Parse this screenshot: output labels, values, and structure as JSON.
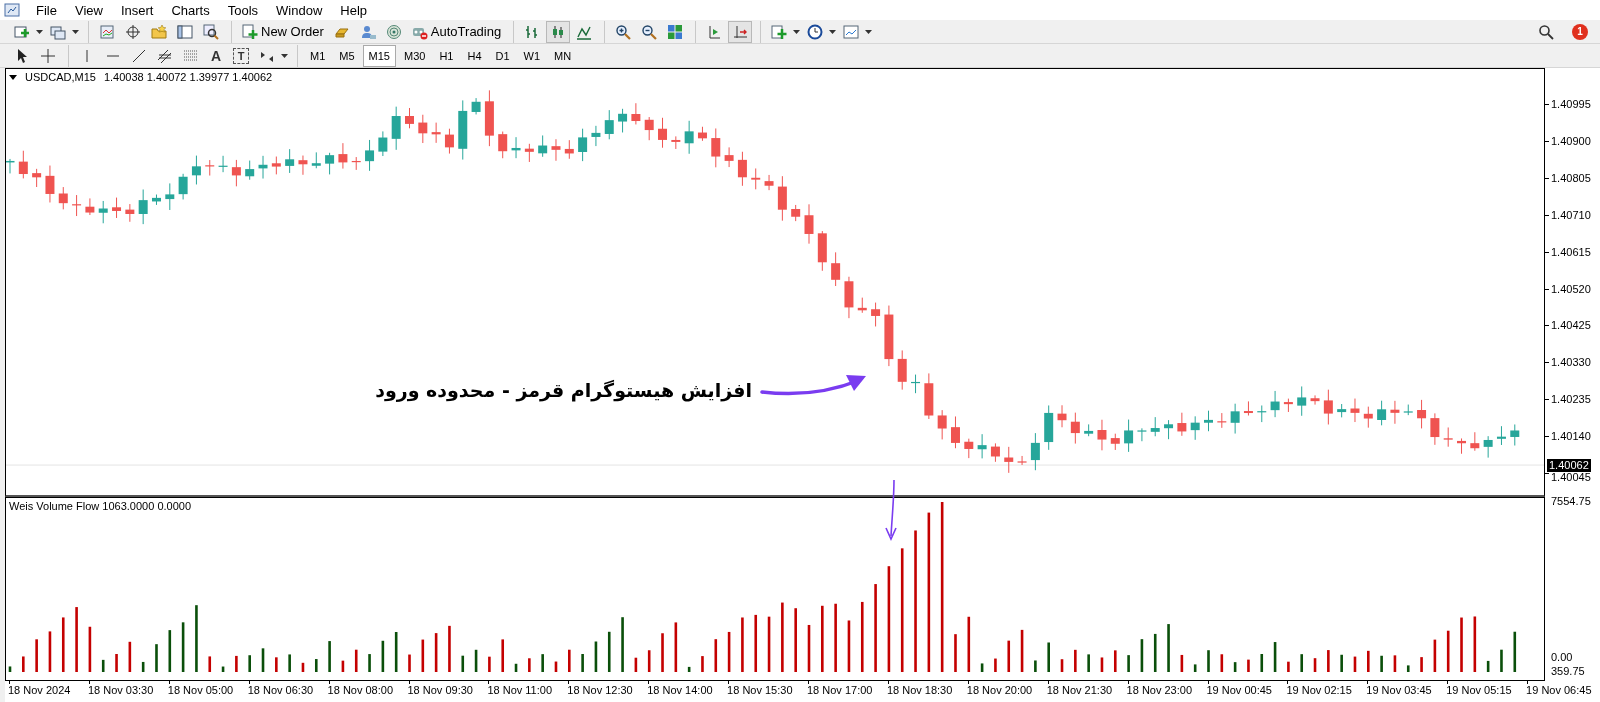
{
  "menu": [
    {
      "label": "File"
    },
    {
      "label": "View"
    },
    {
      "label": "Insert"
    },
    {
      "label": "Charts"
    },
    {
      "label": "Tools"
    },
    {
      "label": "Window"
    },
    {
      "label": "Help"
    }
  ],
  "toolbar": {
    "new_order": "New Order",
    "autotrading": "AutoTrading",
    "chart_types": [
      {
        "selected": false
      },
      {
        "selected": true
      },
      {
        "selected": false
      }
    ],
    "autoscroll": {
      "on": true
    },
    "notifications": {
      "count": "1"
    }
  },
  "drawing_tools": {
    "text_tool": "A",
    "label_tool": "T"
  },
  "timeframes": [
    {
      "label": "M1",
      "selected": false
    },
    {
      "label": "M5",
      "selected": false
    },
    {
      "label": "M15",
      "selected": true
    },
    {
      "label": "M30",
      "selected": false
    },
    {
      "label": "H1",
      "selected": false
    },
    {
      "label": "H4",
      "selected": false
    },
    {
      "label": "D1",
      "selected": false
    },
    {
      "label": "W1",
      "selected": false
    },
    {
      "label": "MN",
      "selected": false
    }
  ],
  "chart": {
    "symbol": "USDCAD,M15",
    "ohlc": "1.40038 1.40072 1.39977 1.40062",
    "price_ticks": [
      "1.40995",
      "1.40900",
      "1.40805",
      "1.40710",
      "1.40615",
      "1.40520",
      "1.40425",
      "1.40330",
      "1.40235",
      "1.40140",
      "1.40045"
    ],
    "current_price": "1.40062"
  },
  "annotation": {
    "text": "افزایش هیستوگرام قرمز - محدوده ورود"
  },
  "indicator": {
    "title": "Weis Volume Flow 1063.0000 0.0000",
    "top_tick": "7554.75",
    "zero_tick": "0.00",
    "bottom_tick": "359.75"
  },
  "time_axis": [
    "18 Nov 2024",
    "18 Nov 03:30",
    "18 Nov 05:00",
    "18 Nov 06:30",
    "18 Nov 08:00",
    "18 Nov 09:30",
    "18 Nov 11:00",
    "18 Nov 12:30",
    "18 Nov 14:00",
    "18 Nov 15:30",
    "18 Nov 17:00",
    "18 Nov 18:30",
    "18 Nov 20:00",
    "18 Nov 21:30",
    "18 Nov 23:00",
    "19 Nov 00:45",
    "19 Nov 02:15",
    "19 Nov 03:45",
    "19 Nov 05:15",
    "19 Nov 06:45"
  ]
}
